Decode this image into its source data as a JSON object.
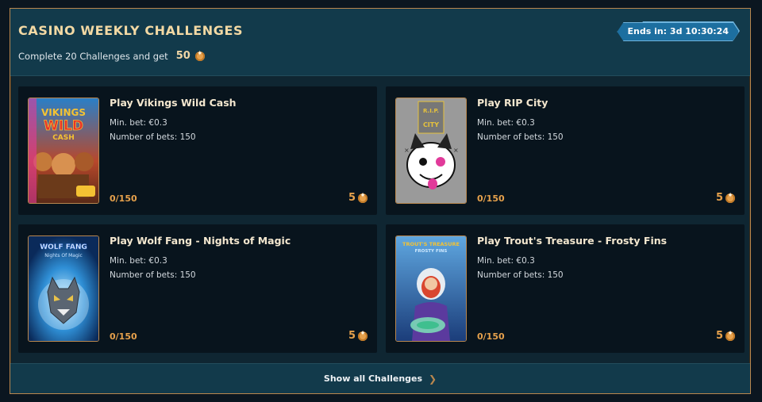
{
  "header": {
    "title": "CASINO WEEKLY CHALLENGES",
    "subtitle_text": "Complete 20 Challenges and get",
    "subtitle_reward": "50",
    "timer": "Ends in: 3d 10:30:24"
  },
  "challenges": [
    {
      "title": "Play Vikings Wild Cash",
      "min_bet": "Min. bet: €0.3",
      "num_bets": "Number of bets: 150",
      "progress": "0/150",
      "reward": "5",
      "thumb_text": "VIKINGS WILD CASH"
    },
    {
      "title": "Play RIP City",
      "min_bet": "Min. bet: €0.3",
      "num_bets": "Number of bets: 150",
      "progress": "0/150",
      "reward": "5",
      "thumb_text": "R.I.P. CITY"
    },
    {
      "title": "Play Wolf Fang - Nights of Magic",
      "min_bet": "Min. bet: €0.3",
      "num_bets": "Number of bets: 150",
      "progress": "0/150",
      "reward": "5",
      "thumb_text": "WOLF FANG Nights Of Magic"
    },
    {
      "title": "Play Trout's Treasure - Frosty Fins",
      "min_bet": "Min. bet: €0.3",
      "num_bets": "Number of bets: 150",
      "progress": "0/150",
      "reward": "5",
      "thumb_text": "TROUT'S TREASURE FROSTY FINS"
    }
  ],
  "footer": {
    "show_all": "Show all Challenges"
  },
  "colors": {
    "accent_gold": "#e6a14c",
    "panel": "#123a4b",
    "card": "#08141d",
    "timer": "#1d6fa0"
  }
}
